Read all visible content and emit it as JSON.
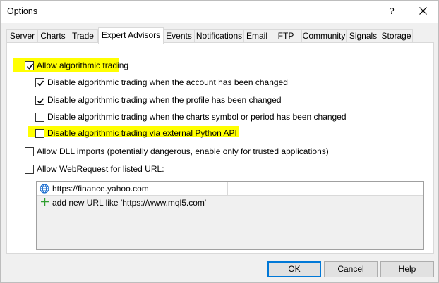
{
  "window": {
    "title": "Options",
    "help_label": "?"
  },
  "tabs": [
    {
      "label": "Server",
      "active": false
    },
    {
      "label": "Charts",
      "active": false
    },
    {
      "label": "Trade",
      "active": false
    },
    {
      "label": "Expert Advisors",
      "active": true
    },
    {
      "label": "Events",
      "active": false
    },
    {
      "label": "Notifications",
      "active": false
    },
    {
      "label": "Email",
      "active": false
    },
    {
      "label": "FTP",
      "active": false
    },
    {
      "label": "Community",
      "active": false
    },
    {
      "label": "Signals",
      "active": false
    },
    {
      "label": "Storage",
      "active": false
    }
  ],
  "options": {
    "allow_algo": {
      "label": "Allow algorithmic trading",
      "checked": true
    },
    "disable_account": {
      "label": "Disable algorithmic trading when the account has been changed",
      "checked": true
    },
    "disable_profile": {
      "label": "Disable algorithmic trading when the profile has been changed",
      "checked": true
    },
    "disable_symbol": {
      "label": "Disable algorithmic trading when the charts symbol or period has been changed",
      "checked": false
    },
    "disable_python": {
      "label": "Disable algorithmic trading via external Python API",
      "checked": false
    },
    "allow_dll": {
      "label": "Allow DLL imports (potentially dangerous, enable only for trusted applications)",
      "checked": false
    },
    "allow_webrequest": {
      "label": "Allow WebRequest for listed URL:",
      "checked": false
    }
  },
  "url_list": {
    "items": [
      {
        "url": "https://finance.yahoo.com",
        "icon": "globe-icon"
      }
    ],
    "add_placeholder": "add new URL like 'https://www.mql5.com'",
    "add_icon": "plus-icon"
  },
  "buttons": {
    "ok": "OK",
    "cancel": "Cancel",
    "help": "Help"
  },
  "colors": {
    "highlight": "#ffff00",
    "accent": "#0078d7",
    "add_icon": "#2e9e2e",
    "globe_icon": "#1e6fd0"
  }
}
